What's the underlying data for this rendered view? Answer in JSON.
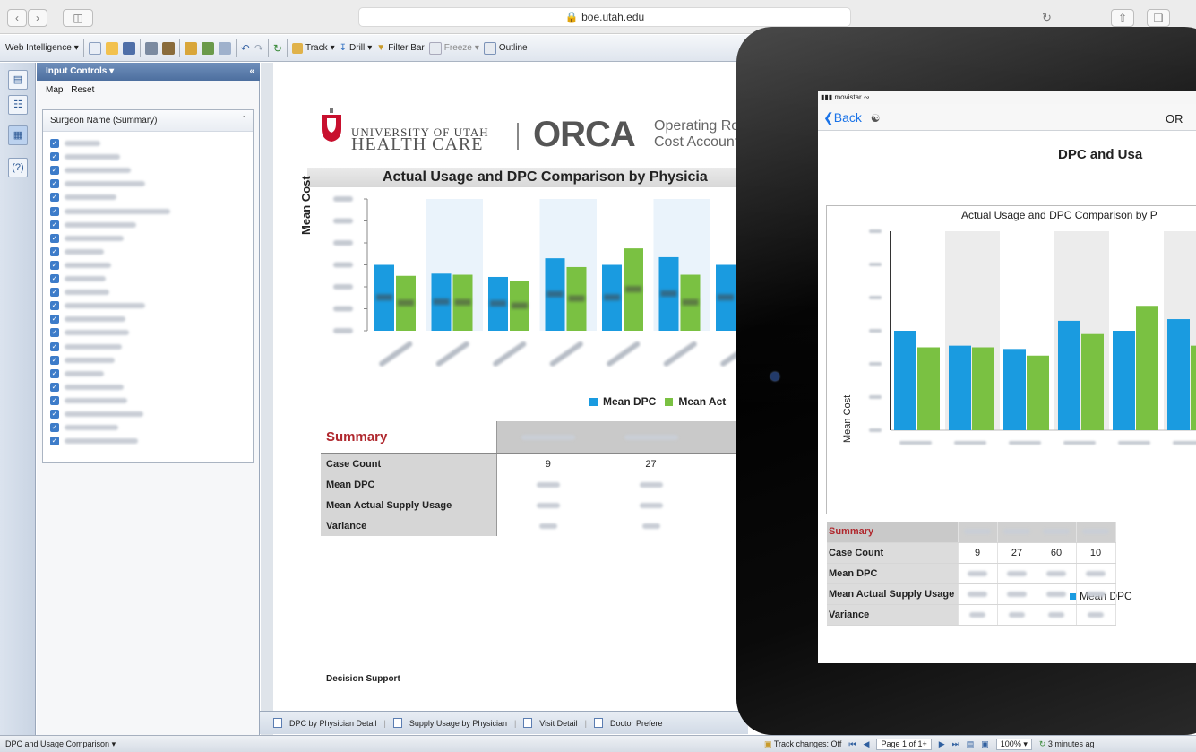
{
  "browser": {
    "url": "boe.utah.edu"
  },
  "toolbar": {
    "app_menu": "Web Intelligence",
    "track": "Track",
    "drill": "Drill",
    "filter_bar": "Filter Bar",
    "freeze": "Freeze",
    "outline": "Outline"
  },
  "input_controls": {
    "title": "Input Controls",
    "map": "Map",
    "reset": "Reset",
    "surgeon_label": "Surgeon Name (Summary)",
    "surgeons_checked": 23
  },
  "report": {
    "logo_line1": "UNIVERSITY OF UTAH",
    "logo_line2": "HEALTH CARE",
    "logo_brand": "ORCA",
    "logo_sub1": "Operating Roo",
    "logo_sub2": "Cost Accounta",
    "title": "Actual Usage and DPC Comparison by Physicia",
    "y_label": "Mean Cost",
    "legend_dpc": "Mean DPC",
    "legend_actual": "Mean Act",
    "summary_title": "Summary",
    "rows": [
      "Case Count",
      "Mean DPC",
      "Mean Actual Supply Usage",
      "Variance"
    ],
    "case_counts": [
      "9",
      "27"
    ],
    "footer": "Decision Support"
  },
  "tabs": [
    "DPC by Physician Detail",
    "Supply Usage by Physician",
    "Visit Detail",
    "Doctor Prefere"
  ],
  "status": {
    "left": "DPC and Usage Comparison",
    "track_changes": "Track changes: Off",
    "page": "Page 1 of 1+",
    "zoom": "100%",
    "refreshed": "3 minutes ag"
  },
  "tablet": {
    "carrier": "movistar",
    "back": "Back",
    "nav_title": "OR",
    "subtitle": "DPC and Usa",
    "chart_title": "Actual Usage and DPC Comparison by P",
    "y_label": "Mean Cost",
    "legend": "Mean DPC",
    "summary_title": "Summary",
    "rows": [
      "Case Count",
      "Mean DPC",
      "Mean Actual Supply Usage",
      "Variance"
    ],
    "case_counts": [
      "9",
      "27",
      "60",
      "10"
    ]
  },
  "colors": {
    "dpc": "#1a9be0",
    "actual": "#7ac142",
    "summary": "#b0282e"
  },
  "chart_data": [
    {
      "type": "bar",
      "title": "Actual Usage and DPC Comparison by Physicia",
      "ylabel": "Mean Cost",
      "categories": [
        "",
        "",
        "",
        "",
        "",
        "",
        ""
      ],
      "series": [
        {
          "name": "Mean DPC",
          "values": [
            600,
            520,
            490,
            660,
            600,
            670,
            600
          ]
        },
        {
          "name": "Mean Act",
          "values": [
            500,
            510,
            450,
            580,
            750,
            510,
            560
          ]
        }
      ],
      "ylim": [
        0,
        1200
      ],
      "legend": "bottom"
    },
    {
      "type": "bar",
      "title": "Actual Usage and DPC Comparison by P",
      "ylabel": "Mean Cost",
      "categories": [
        "",
        "",
        "",
        "",
        "",
        ""
      ],
      "series": [
        {
          "name": "Mean DPC",
          "values": [
            600,
            510,
            490,
            660,
            600,
            670
          ]
        },
        {
          "name": "",
          "values": [
            500,
            500,
            450,
            580,
            750,
            510
          ]
        }
      ],
      "ylim": [
        0,
        1200
      ],
      "legend": "bottom"
    }
  ]
}
